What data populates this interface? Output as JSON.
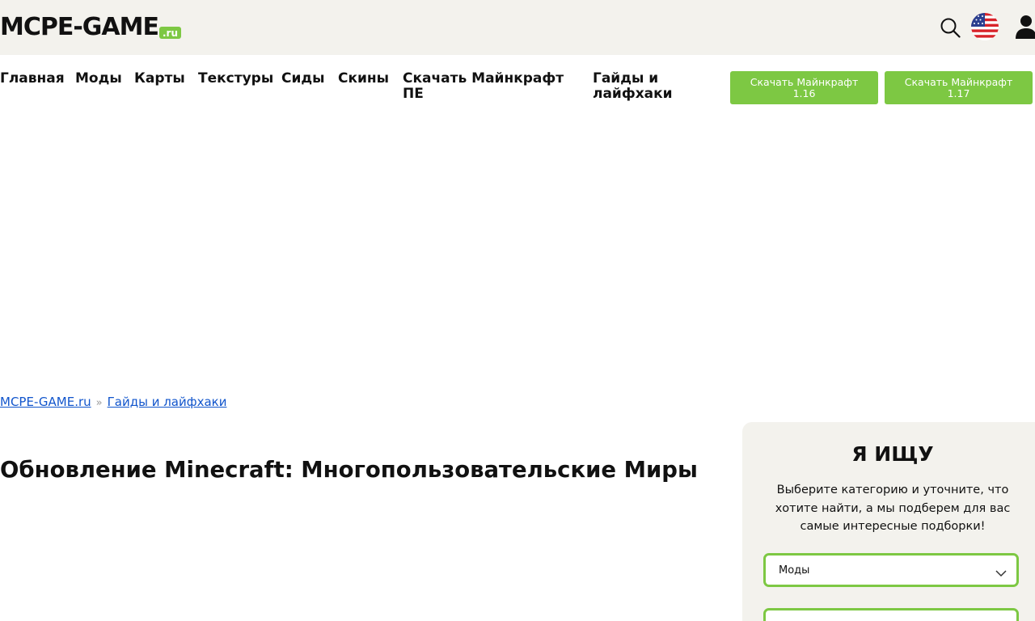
{
  "header": {
    "logo_main": "MCPE-GAME",
    "logo_tld": ".ru",
    "icons": [
      "search-icon",
      "us-flag-icon",
      "user-icon"
    ]
  },
  "nav": {
    "items": [
      "Главная",
      "Моды",
      "Карты",
      "Текстуры",
      "Сиды",
      "Скины",
      "Скачать Майнкрафт ПЕ",
      "Гайды и лайфхаки"
    ],
    "buttons": [
      "Скачать Майнкрафт 1.16",
      "Скачать Майнкрафт 1.17"
    ]
  },
  "breadcrumb": {
    "home": "MCPE-GAME.ru",
    "separator": "»",
    "current": "Гайды и лайфхаки"
  },
  "article": {
    "title": "Обновление Minecraft: Многопользовательские Миры"
  },
  "search_card": {
    "heading": "Я ИЩУ",
    "description": "Выберите категорию и уточните, что хотите найти, а мы подберем для вас самые интересные подборки!",
    "category_selected": "Моды"
  },
  "colors": {
    "accent_green": "#7dc843",
    "header_bg": "#f3f2ed",
    "link_blue": "#1155cc"
  }
}
